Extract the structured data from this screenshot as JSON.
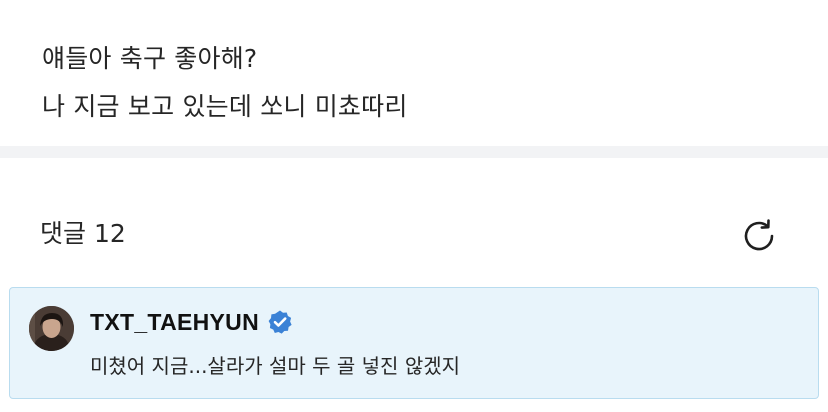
{
  "post": {
    "line1": "얘들아 축구 좋아해?",
    "line2": "나 지금 보고 있는데 쏘니 미쵸따리"
  },
  "comments": {
    "header_label": "댓글 12",
    "refresh_icon": "refresh-icon",
    "items": [
      {
        "author": "TXT_TAEHYUN",
        "verified": true,
        "verified_icon": "verified-badge-icon",
        "text": "미쳤어 지금...살라가 설마 두 골 넣진 않겠지",
        "highlighted": true
      }
    ]
  },
  "colors": {
    "verified_badge": "#3b82d6",
    "highlight_bg": "#e8f4fb",
    "highlight_border": "#b9dcef",
    "divider": "#f2f3f5"
  }
}
